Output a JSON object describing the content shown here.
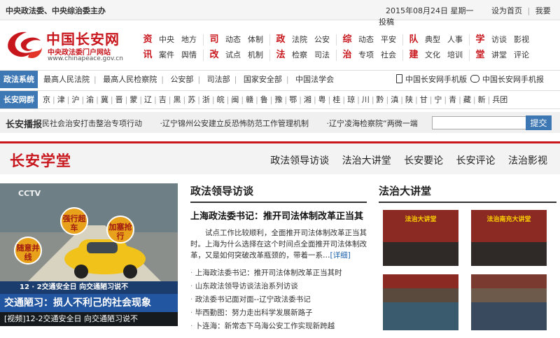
{
  "topbar": {
    "sponsors": "中央政法委、中央综治委主办",
    "date": "2015年08月24日 星期一",
    "set_home": "设为首页",
    "favorite": "我要投稿"
  },
  "logo": {
    "name": "中国长安网",
    "subtitle": "中央政法委门户网站",
    "url": "www.chinapeace.gov.cn"
  },
  "nav": {
    "row1": [
      {
        "cat": "资",
        "items": [
          "中央",
          "地方"
        ]
      },
      {
        "cat": "司",
        "items": [
          "动态",
          "体制"
        ]
      },
      {
        "cat": "政",
        "items": [
          "法院",
          "公安"
        ]
      },
      {
        "cat": "综",
        "items": [
          "动态",
          "平安"
        ]
      },
      {
        "cat": "队",
        "items": [
          "典型",
          "人事"
        ]
      },
      {
        "cat": "学",
        "items": [
          "访谈",
          "影视"
        ]
      }
    ],
    "row2": [
      {
        "cat": "讯",
        "items": [
          "案件",
          "舆情"
        ]
      },
      {
        "cat": "改",
        "items": [
          "试点",
          "机制"
        ]
      },
      {
        "cat": "法",
        "items": [
          "检察",
          "司法"
        ]
      },
      {
        "cat": "治",
        "items": [
          "专项",
          "社会"
        ]
      },
      {
        "cat": "建",
        "items": [
          "文化",
          "培训"
        ]
      },
      {
        "cat": "堂",
        "items": [
          "讲堂",
          "评论"
        ]
      }
    ]
  },
  "system_bar": {
    "tag": "政法系统",
    "links": [
      "最高人民法院",
      "最高人民检察院",
      "公安部",
      "司法部",
      "国家安全部",
      "中国法学会"
    ],
    "mobile_site": "中国长安网手机版",
    "mobile_paper": "中国长安网手机报"
  },
  "group_bar": {
    "tag": "长安网群",
    "links": [
      "京",
      "津",
      "沪",
      "渝",
      "冀",
      "晋",
      "蒙",
      "辽",
      "吉",
      "黑",
      "苏",
      "浙",
      "皖",
      "闽",
      "赣",
      "鲁",
      "豫",
      "鄂",
      "湘",
      "粤",
      "桂",
      "琼",
      "川",
      "黔",
      "滇",
      "陕",
      "甘",
      "宁",
      "青",
      "藏",
      "新",
      "兵团"
    ]
  },
  "broadcast": {
    "label": "长安播报",
    "items": [
      "民社会治安打击整治专项行动",
      "·辽宁锦州公安建立反恐怖防范工作管理机制",
      "·辽宁凌海检察院“两微一端"
    ],
    "search_placeholder": "",
    "submit": "提交"
  },
  "section": {
    "title": "长安学堂",
    "tabs": [
      "政法领导访谈",
      "法治大讲堂",
      "长安要论",
      "长安评论",
      "法治影视"
    ]
  },
  "video": {
    "ctv": "CCTV",
    "signs": [
      "随意并线",
      "强行超车",
      "加塞抢行"
    ],
    "banner1": "12 · 2交通安全日 向交通陋习说不",
    "banner2": "交通陋习：损人不利己的社会现象",
    "caption": "[视频]12-2交通安全日 向交通陋习说不"
  },
  "interviews": {
    "heading": "政法领导访谈",
    "headline": "上海政法委书记：推开司法体制改革正当其",
    "para": "试点工作比较顺利，全面推开司法体制改革正当其时。上海为什么选择在这个时间点全面推开司法体制改革，又是如何突破改革瓶颈的，带着一系…",
    "more": "[详细]",
    "list": [
      "上海政法委书记：推开司法体制改革正当其时",
      "山东政法领导访谈法治系列访谈",
      "政法委书记面对面--辽宁政法委书记",
      "毕西勤图：努力走出科学发展新路子",
      "卜连海：新常态下乌海公安工作实现新跨越"
    ]
  },
  "lecture": {
    "heading": "法治大讲堂",
    "photo_captions": [
      "法治大讲堂",
      "法治南充大讲堂",
      "",
      ""
    ]
  }
}
